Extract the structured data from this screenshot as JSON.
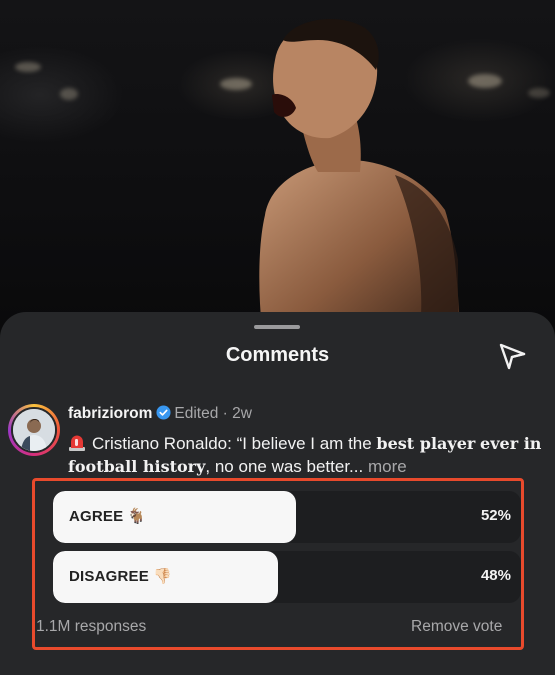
{
  "sheet": {
    "title": "Comments"
  },
  "comment": {
    "author": "fabriziorom",
    "status": "Edited",
    "separator": "·",
    "age": "2w",
    "text_prefix": "Cristiano Ronaldo: “I believe I am the ",
    "text_bold_1": "best player",
    "text_bold_2": "ever in football history",
    "text_suffix": ", no one was better...",
    "more_label": "more"
  },
  "poll": {
    "options": [
      {
        "label": "AGREE",
        "emoji": "🐐",
        "percent_label": "52%",
        "percent": 52
      },
      {
        "label": "DISAGREE",
        "emoji": "👎🏻",
        "percent_label": "48%",
        "percent": 48
      }
    ],
    "responses": "1.1M responses",
    "remove_vote": "Remove vote",
    "highlight_color": "#e84a2c"
  },
  "colors": {
    "sheet_bg": "#262729",
    "verified": "#3897f0"
  },
  "icons": [
    "send-icon",
    "verified-badge-icon",
    "siren-icon",
    "avatar"
  ]
}
